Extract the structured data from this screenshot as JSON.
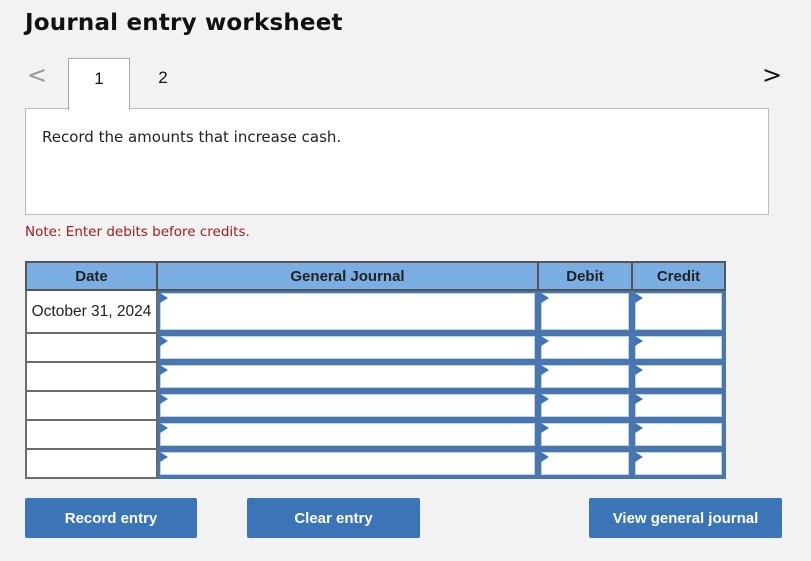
{
  "header": {
    "title": "Journal entry worksheet"
  },
  "nav": {
    "prev_icon": "chevron-left-icon",
    "next_icon": "chevron-right-icon",
    "prev_glyph": "<",
    "next_glyph": ">"
  },
  "tabs": [
    {
      "label": "1",
      "active": true
    },
    {
      "label": "2",
      "active": false
    }
  ],
  "panel": {
    "prompt": "Record the amounts that increase cash."
  },
  "note": "Note: Enter debits before credits.",
  "table": {
    "columns": [
      "Date",
      "General Journal",
      "Debit",
      "Credit"
    ],
    "rows": [
      {
        "date": "October 31, 2024",
        "account": "",
        "debit": "",
        "credit": ""
      },
      {
        "date": "",
        "account": "",
        "debit": "",
        "credit": ""
      },
      {
        "date": "",
        "account": "",
        "debit": "",
        "credit": ""
      },
      {
        "date": "",
        "account": "",
        "debit": "",
        "credit": ""
      },
      {
        "date": "",
        "account": "",
        "debit": "",
        "credit": ""
      },
      {
        "date": "",
        "account": "",
        "debit": "",
        "credit": ""
      }
    ]
  },
  "buttons": {
    "record": "Record entry",
    "clear": "Clear entry",
    "view": "View general journal"
  },
  "colors": {
    "accent": "#3c74b8",
    "header_bg": "#7aaee3",
    "note": "#a11c1c"
  }
}
